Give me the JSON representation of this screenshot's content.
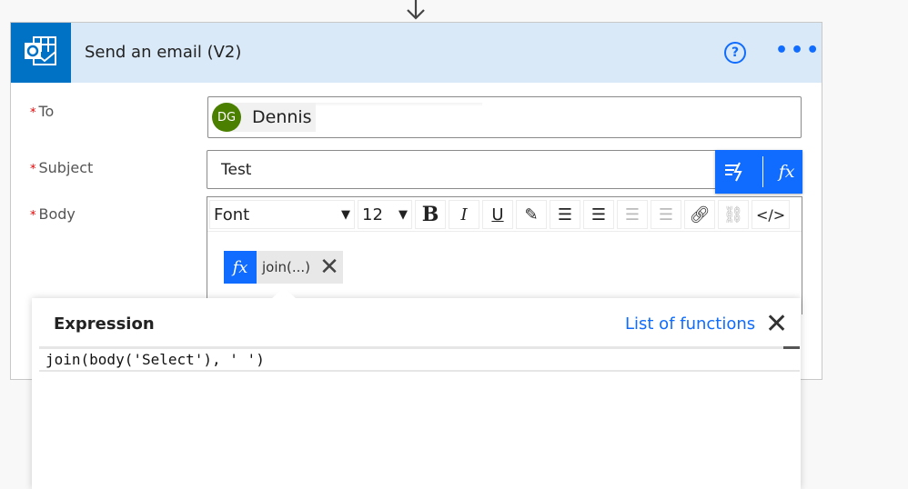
{
  "action": {
    "title": "Send an email (V2)",
    "app_icon": "outlook-icon",
    "help_icon": "?",
    "more_icon": "•••"
  },
  "fields": {
    "to": {
      "label": "To",
      "required": "*",
      "recipient": {
        "initials": "DG",
        "name": "Dennis",
        "avatar_color": "#4b7f00"
      }
    },
    "subject": {
      "label": "Subject",
      "required": "*",
      "value": "Test"
    },
    "body": {
      "label": "Body",
      "required": "*",
      "toolbar": {
        "font": "Font",
        "size": "12",
        "bold": "B",
        "italic": "I",
        "underline": "U",
        "code": "</>"
      },
      "token": {
        "icon": "fx",
        "label": "join(...)",
        "remove": "✕"
      }
    }
  },
  "dynamic_panel": {
    "fx": "fx"
  },
  "expression": {
    "title": "Expression",
    "list_link": "List of functions",
    "close": "✕",
    "value": "join(body('Select'), ' ')"
  },
  "colors": {
    "accent": "#0f6cff",
    "header": "#d9e9f7",
    "outlook": "#0072c6"
  }
}
